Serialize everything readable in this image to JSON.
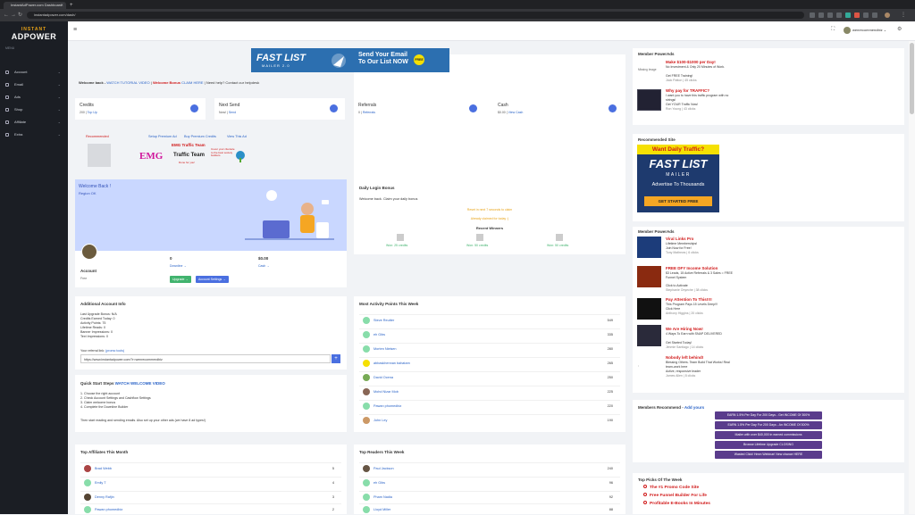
{
  "browser": {
    "tab_title": "InstantAdPower.com Dashboard",
    "url": "instantadpower.com/dash/"
  },
  "sidebar": {
    "logo_top": "INSTANT",
    "logo_main": "ADPOWER",
    "menu_header": "MENU",
    "items": [
      {
        "label": "Dashboard",
        "icon": "dashboard-icon"
      },
      {
        "label": "Account",
        "icon": "user-icon"
      },
      {
        "label": "Email",
        "icon": "mail-icon"
      },
      {
        "label": "Ads",
        "icon": "megaphone-icon"
      },
      {
        "label": "Shop",
        "icon": "cart-icon"
      },
      {
        "label": "Affiliate",
        "icon": "link-icon"
      },
      {
        "label": "Extra",
        "icon": "gift-icon"
      }
    ]
  },
  "topbar": {
    "username": "wenrecommendbiz"
  },
  "banner": {
    "title": "FAST LIST",
    "subtitle": "MAILER 2.0",
    "cta": "Send Your Email To Our List NOW",
    "badge": "FREE"
  },
  "welcome_line": {
    "prefix": "Welcome back -",
    "tutorial": "WATCH TUTORIAL VIDEO",
    "bonus": "Welcome Bonus",
    "claim": "CLAIM HERE",
    "need_help": "Need help? Contact our helpdesk"
  },
  "stats": [
    {
      "title": "Credits",
      "sub": "200 |",
      "link": "Top Up"
    },
    {
      "title": "Next Send",
      "sub": "Now! |",
      "link": "Send"
    },
    {
      "title": "Referrals",
      "sub": "0 |",
      "link": "Referrals"
    },
    {
      "title": "Cash",
      "sub": "$0.00 |",
      "link": "View Cash"
    }
  ],
  "recommended": {
    "label": "Recommended",
    "links": [
      "Setup Premium Ad",
      "Buy Premium Credits",
      "View This Ad"
    ],
    "emg_title": "EMG Traffic Team",
    "emg_logo": "EMG",
    "emg_sub": "Traffic Team",
    "emg_small": "Done for you!",
    "emg_tag": "Cover your clientele to the best society builders"
  },
  "profile": {
    "welcome": "Welcome Back !",
    "country": "Region OK",
    "account": "Account",
    "level": "Free",
    "downline_count": "0",
    "downline_label": "Downline",
    "cash_value": "$0.00",
    "cash_label": "Cash",
    "upgrade_btn": "Upgrade",
    "settings_btn": "Account Settings"
  },
  "daily": {
    "title": "Daily Login Bonus",
    "text": "Welcome back. Claim your daily bonus",
    "line1": "Reset in next 7 seconds to claim",
    "line2": "Already claimed for today :)",
    "winners_title": "Recent Winners",
    "winners": [
      {
        "label": "Won: 25 credits"
      },
      {
        "label": "Won: 50 credits"
      },
      {
        "label": "Won: 50 credits"
      }
    ]
  },
  "additional": {
    "title": "Additional Account Info",
    "lines": [
      "Last Upgrade Bonus: N/A",
      "Credits Earned Today: 0",
      "Activity Points: 75",
      "Lifetime Reads: 0",
      "Banner Impressions: 0",
      "Text Impressions: 0"
    ],
    "ref_label": "Your referral link:",
    "promo": "(promo tools)",
    "ref_link": "https://www.instantadpower.com/?r=wenrecommendbiz"
  },
  "quickstart": {
    "title": "Quick Start Steps",
    "video": "WATCH WELCOME VIDEO",
    "steps": [
      "1. Choose the right account",
      "2. Check Account Settings and Cashflow Settings",
      "3. Claim welcome bonus",
      "4. Complete the Downline Builder"
    ],
    "footer": "Then start reading and sending emails. Also set up your other ads (we have 8 ad types!)"
  },
  "most_active": {
    "title": "Most Activity Points This Week",
    "rows": [
      {
        "name": "Steve Reutter",
        "value": "549"
      },
      {
        "name": "eh Gibs",
        "value": "335"
      },
      {
        "name": "Morten Nielsen",
        "value": "280"
      },
      {
        "name": "abbaskhennan bahatam",
        "value": "265"
      },
      {
        "name": "David Ocena",
        "value": "250"
      },
      {
        "name": "Mohd Nizar Mob",
        "value": "225"
      },
      {
        "name": "Pawan phomedbiz",
        "value": "220"
      },
      {
        "name": "John Ley",
        "value": "190"
      }
    ]
  },
  "top_affiliates": {
    "title": "Top Affiliates This Month",
    "rows": [
      {
        "name": "Brad Webb",
        "value": "5"
      },
      {
        "name": "Emily T",
        "value": "4"
      },
      {
        "name": "Denny Rafjin",
        "value": "3"
      },
      {
        "name": "Pawan phomedbiz",
        "value": "2"
      }
    ]
  },
  "top_readers": {
    "title": "Top Readers This Week",
    "rows": [
      {
        "name": "Paul Jackson",
        "value": "240"
      },
      {
        "name": "eh Gibs",
        "value": "96"
      },
      {
        "name": "Pham Nadia",
        "value": "92"
      },
      {
        "name": "Lloyd Miller",
        "value": "88"
      }
    ]
  },
  "power_ads_top": {
    "title": "Member PowerAds",
    "ads": [
      {
        "headline": "Make $100-$1000 per Day!",
        "body": "No Investment & Only 20 Minutes of Work.",
        "sub": "Get FREE Training!",
        "meta": "Jack Patton | 45 clicks",
        "img": "Missing Image"
      },
      {
        "headline": "Why pay for TRAFFIC?",
        "body": "I want you to have this traffic program with no strings!",
        "sub": "Get YOUR Traffic Now!",
        "meta": "Ron Young | 43 clicks",
        "img": ""
      }
    ]
  },
  "recommended_site": {
    "title": "Recommended Site",
    "want": "Want Daily Traffic?",
    "brand": "FAST LIST",
    "mailer": "MAILER",
    "advertise": "Advertise To Thousands",
    "cta": "GET STARTED FREE"
  },
  "power_ads_list": {
    "title": "Member PowerAds",
    "ads": [
      {
        "headline": "Viral Links Pro",
        "body": "Lifetime Memberships!",
        "sub": "Join Now for Free!",
        "meta": "Tony Mathews | 6 clicks"
      },
      {
        "headline": "FREE DFY Income Solution",
        "body": "$3 Leads, 15 Active Referrals & 3 Sales = FREE Funnel System",
        "sub": "Click to Activate",
        "meta": "Stephanie Onyeche | 38 clicks"
      },
      {
        "headline": "Pay Attention To This!!!!",
        "body": "This Program Pays 15 Levels Deep!!!",
        "sub": "Click Here",
        "meta": "Anthony Higgins | 20 clicks"
      },
      {
        "headline": "We Are Hiring Now!",
        "body": "4 Ways To Earn with SNAP DELIVERED",
        "sub": "Get Started Today!",
        "meta": "Jimmie Santiago | 14 clicks"
      },
      {
        "headline": "Nobody left behind!",
        "body": "Blessing Others. Team Build That Works! Real team-work here",
        "sub": "Active, responsive leader",
        "meta": "James Allen | 8 clicks"
      }
    ]
  },
  "members_recommend": {
    "title": "Members Recommend -",
    "add": "Add yours",
    "buttons": [
      "EARN 1.5% Per Day For 200 Days - Get INCOME Of 300%",
      "EARN 1.5% Per Day For 200 Days - An INCOME Of 300%",
      "Mailer with over $40,000 in earned commissions",
      "Browse Lifetime Upgrade CLOSING",
      "Wasted Click! Hmm Webinar! New chance HERE"
    ]
  },
  "top_picks": {
    "title": "Top Picks Of The Week",
    "items": [
      "The #1 Promo Code Site",
      "Free Funnel Builder For Life",
      "Profitable E-Books In Minutes"
    ]
  },
  "colors": {
    "accent": "#2a63c7",
    "red": "#d01818",
    "sidebar": "#1b1e24",
    "purple": "#5a3c8c",
    "green": "#41b36e"
  }
}
